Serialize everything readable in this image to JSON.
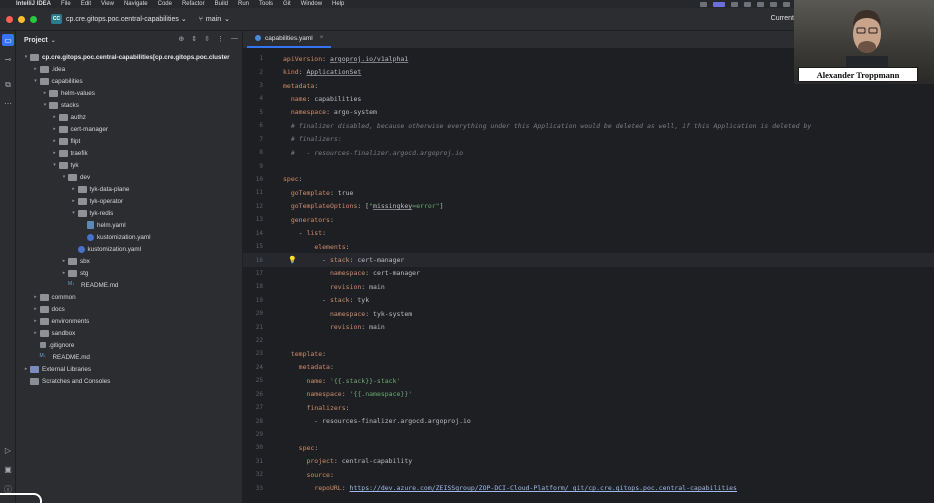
{
  "menubar": {
    "items": [
      "IntelliJ IDEA",
      "File",
      "Edit",
      "View",
      "Navigate",
      "Code",
      "Refactor",
      "Build",
      "Run",
      "Tools",
      "Git",
      "Window",
      "Help"
    ]
  },
  "titlebar": {
    "project_badge": "CC",
    "project_name": "cp.cre.gitops.poc.central-capabilities",
    "branch": "main",
    "right_label": "Current"
  },
  "project_panel": {
    "title": "Project",
    "tree": [
      {
        "label": "cp.cre.gitops.poc.central-capabilities",
        "suffix": " [cp.cre.gitops.poc.cluster",
        "depth": 0,
        "arrow": "v",
        "icon": "folder"
      },
      {
        "label": ".idea",
        "depth": 1,
        "arrow": ">",
        "icon": "folder"
      },
      {
        "label": "capabilities",
        "depth": 1,
        "arrow": "v",
        "icon": "folder"
      },
      {
        "label": "helm-values",
        "depth": 2,
        "arrow": ">",
        "icon": "folder"
      },
      {
        "label": "stacks",
        "depth": 2,
        "arrow": "v",
        "icon": "folder"
      },
      {
        "label": "authz",
        "depth": 3,
        "arrow": ">",
        "icon": "folder"
      },
      {
        "label": "cert-manager",
        "depth": 3,
        "arrow": ">",
        "icon": "folder"
      },
      {
        "label": "flipt",
        "depth": 3,
        "arrow": ">",
        "icon": "folder"
      },
      {
        "label": "traefik",
        "depth": 3,
        "arrow": ">",
        "icon": "folder"
      },
      {
        "label": "tyk",
        "depth": 3,
        "arrow": "v",
        "icon": "folder"
      },
      {
        "label": "dev",
        "depth": 4,
        "arrow": "v",
        "icon": "folder"
      },
      {
        "label": "tyk-data-plane",
        "depth": 5,
        "arrow": ">",
        "icon": "folder"
      },
      {
        "label": "tyk-operator",
        "depth": 5,
        "arrow": ">",
        "icon": "folder"
      },
      {
        "label": "tyk-redis",
        "depth": 5,
        "arrow": "v",
        "icon": "folder"
      },
      {
        "label": "helm.yaml",
        "depth": 6,
        "arrow": "",
        "icon": "file"
      },
      {
        "label": "kustomization.yaml",
        "depth": 6,
        "arrow": "",
        "icon": "k8s"
      },
      {
        "label": "kustomization.yaml",
        "depth": 5,
        "arrow": "",
        "icon": "k8s"
      },
      {
        "label": "sbx",
        "depth": 4,
        "arrow": ">",
        "icon": "folder"
      },
      {
        "label": "stg",
        "depth": 4,
        "arrow": ">",
        "icon": "folder"
      },
      {
        "label": "README.md",
        "depth": 4,
        "arrow": "",
        "icon": "md"
      },
      {
        "label": "common",
        "depth": 1,
        "arrow": ">",
        "icon": "folder"
      },
      {
        "label": "docs",
        "depth": 1,
        "arrow": ">",
        "icon": "folder"
      },
      {
        "label": "environments",
        "depth": 1,
        "arrow": ">",
        "icon": "folder"
      },
      {
        "label": "sandbox",
        "depth": 1,
        "arrow": ">",
        "icon": "folder"
      },
      {
        "label": ".gitignore",
        "depth": 1,
        "arrow": "",
        "icon": "git"
      },
      {
        "label": "README.md",
        "depth": 1,
        "arrow": "",
        "icon": "md"
      },
      {
        "label": "External Libraries",
        "depth": 0,
        "arrow": ">",
        "icon": "lib"
      },
      {
        "label": "Scratches and Consoles",
        "depth": 0,
        "arrow": "",
        "icon": "scratch"
      }
    ]
  },
  "editor": {
    "tab_label": "capabilities.yaml",
    "highlight_line": 16,
    "lines": [
      [
        [
          "k",
          "apiVersion"
        ],
        [
          "p",
          ": "
        ],
        [
          "u",
          "argoproj.io/v1alpha1"
        ]
      ],
      [
        [
          "k",
          "kind"
        ],
        [
          "p",
          ": "
        ],
        [
          "u",
          "ApplicationSet"
        ]
      ],
      [
        [
          "k",
          "metadata"
        ],
        [
          "p",
          ":"
        ]
      ],
      [
        [
          "p",
          "  "
        ],
        [
          "k",
          "name"
        ],
        [
          "p",
          ": "
        ],
        [
          "v",
          "capabilities"
        ]
      ],
      [
        [
          "p",
          "  "
        ],
        [
          "k",
          "namespace"
        ],
        [
          "p",
          ": "
        ],
        [
          "v",
          "argo-system"
        ]
      ],
      [
        [
          "p",
          "  "
        ],
        [
          "c",
          "# finalizer disabled, because otherwise everything under this Application would be deleted as well, if this Application is deleted by"
        ]
      ],
      [
        [
          "p",
          "  "
        ],
        [
          "c",
          "# finalizers:"
        ]
      ],
      [
        [
          "p",
          "  "
        ],
        [
          "c",
          "#   - resources-finalizer.argocd.argoproj.io"
        ]
      ],
      [],
      [
        [
          "k",
          "spec"
        ],
        [
          "p",
          ":"
        ]
      ],
      [
        [
          "p",
          "  "
        ],
        [
          "k",
          "goTemplate"
        ],
        [
          "p",
          ": "
        ],
        [
          "v",
          "true"
        ]
      ],
      [
        [
          "p",
          "  "
        ],
        [
          "k",
          "goTemplateOptions"
        ],
        [
          "p",
          ": ["
        ],
        [
          "s",
          "\""
        ],
        [
          "u",
          "missingkey"
        ],
        [
          "s",
          "=error\""
        ],
        [
          "p",
          "]"
        ]
      ],
      [
        [
          "p",
          "  "
        ],
        [
          "k",
          "generators"
        ],
        [
          "p",
          ":"
        ]
      ],
      [
        [
          "p",
          "    - "
        ],
        [
          "k",
          "list"
        ],
        [
          "p",
          ":"
        ]
      ],
      [
        [
          "p",
          "        "
        ],
        [
          "k",
          "elements"
        ],
        [
          "p",
          ":"
        ]
      ],
      [
        [
          "p",
          "          - "
        ],
        [
          "k",
          "stack"
        ],
        [
          "p",
          ": "
        ],
        [
          "v",
          "cert-manager"
        ]
      ],
      [
        [
          "p",
          "            "
        ],
        [
          "k",
          "namespace"
        ],
        [
          "p",
          ": "
        ],
        [
          "v",
          "cert-manager"
        ]
      ],
      [
        [
          "p",
          "            "
        ],
        [
          "k",
          "revision"
        ],
        [
          "p",
          ": "
        ],
        [
          "v",
          "main"
        ]
      ],
      [
        [
          "p",
          "          - "
        ],
        [
          "k",
          "stack"
        ],
        [
          "p",
          ": "
        ],
        [
          "v",
          "tyk"
        ]
      ],
      [
        [
          "p",
          "            "
        ],
        [
          "k",
          "namespace"
        ],
        [
          "p",
          ": "
        ],
        [
          "v",
          "tyk-system"
        ]
      ],
      [
        [
          "p",
          "            "
        ],
        [
          "k",
          "revision"
        ],
        [
          "p",
          ": "
        ],
        [
          "v",
          "main"
        ]
      ],
      [],
      [
        [
          "p",
          "  "
        ],
        [
          "k",
          "template"
        ],
        [
          "p",
          ":"
        ]
      ],
      [
        [
          "p",
          "    "
        ],
        [
          "k",
          "metadata"
        ],
        [
          "p",
          ":"
        ]
      ],
      [
        [
          "p",
          "      "
        ],
        [
          "k",
          "name"
        ],
        [
          "p",
          ": "
        ],
        [
          "s",
          "'{{.stack}}-stack'"
        ]
      ],
      [
        [
          "p",
          "      "
        ],
        [
          "k",
          "namespace"
        ],
        [
          "p",
          ": "
        ],
        [
          "s",
          "'{{.namespace}}'"
        ]
      ],
      [
        [
          "p",
          "      "
        ],
        [
          "k",
          "finalizers"
        ],
        [
          "p",
          ":"
        ]
      ],
      [
        [
          "p",
          "        - "
        ],
        [
          "v",
          "resources-finalizer.argocd.argoproj.io"
        ]
      ],
      [],
      [
        [
          "p",
          "    "
        ],
        [
          "k",
          "spec"
        ],
        [
          "p",
          ":"
        ]
      ],
      [
        [
          "p",
          "      "
        ],
        [
          "k",
          "project"
        ],
        [
          "p",
          ": "
        ],
        [
          "v",
          "central-capability"
        ]
      ],
      [
        [
          "p",
          "      "
        ],
        [
          "k",
          "source"
        ],
        [
          "p",
          ":"
        ]
      ],
      [
        [
          "p",
          "        "
        ],
        [
          "k",
          "repoURL"
        ],
        [
          "p",
          ": "
        ],
        [
          "lnk",
          "https://dev.azure.com/ZEISSgroup/ZOP-DCI-Cloud-Platform/_git/cp.cre.gitops.poc.central-capabilities"
        ]
      ]
    ]
  },
  "webcam": {
    "name": "Alexander Troppmann"
  }
}
